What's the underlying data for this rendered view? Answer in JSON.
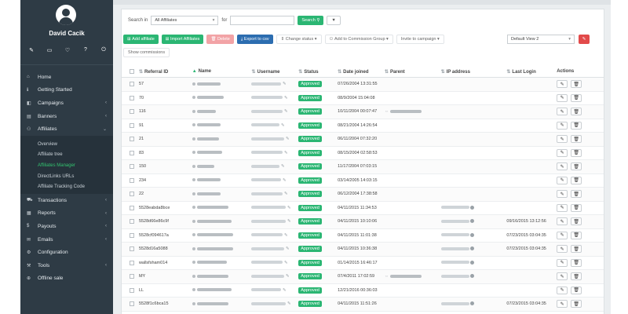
{
  "user": {
    "name": "David Cacik"
  },
  "toolbar_icons": [
    "pencil-icon",
    "monitor-icon",
    "heart-icon",
    "question-icon",
    "power-icon"
  ],
  "nav": [
    {
      "label": "Home",
      "icon": "home-icon",
      "chev": ""
    },
    {
      "label": "Getting Started",
      "icon": "info-icon",
      "chev": ""
    },
    {
      "label": "Campaigns",
      "icon": "campaign-icon",
      "chev": "‹"
    },
    {
      "label": "Banners",
      "icon": "banner-icon",
      "chev": "‹"
    },
    {
      "label": "Affiliates",
      "icon": "users-icon",
      "chev": "⌄"
    }
  ],
  "affiliates_sub": [
    "Overview",
    "Affiliate tree",
    "Affiliates Manager",
    "DirectLinks URLs",
    "Affiliate Tracking Code"
  ],
  "nav2": [
    {
      "label": "Transactions",
      "icon": "cart-icon",
      "chev": "‹"
    },
    {
      "label": "Reports",
      "icon": "chart-icon",
      "chev": "‹"
    },
    {
      "label": "Payouts",
      "icon": "money-icon",
      "chev": "‹"
    },
    {
      "label": "Emails",
      "icon": "mail-icon",
      "chev": "‹"
    },
    {
      "label": "Configuration",
      "icon": "gear-icon",
      "chev": ""
    },
    {
      "label": "Tools",
      "icon": "wrench-icon",
      "chev": "‹"
    },
    {
      "label": "Offline sale",
      "icon": "sale-icon",
      "chev": ""
    }
  ],
  "search": {
    "label_in": "Search in",
    "scope": "All Affiliates",
    "label_for": "for",
    "value": "",
    "button": "Search"
  },
  "actions": {
    "add": "Add affiliate",
    "import": "Import Affiliates",
    "delete": "Delete",
    "export": "Export to csv",
    "change_status": "Change status",
    "add_group": "Add to Commission Group",
    "invite": "Invite to campaign",
    "view": "Default View 2",
    "show_commissions": "Show commissions"
  },
  "columns": [
    "Referral ID",
    "Name",
    "Username",
    "Status",
    "Date joined",
    "Parent",
    "IP address",
    "Last Login",
    "Actions"
  ],
  "rows": [
    {
      "id": "57",
      "status": "Approved",
      "date": "07/26/2004 13:31:55",
      "parent": false,
      "ip": false,
      "login": ""
    },
    {
      "id": "70",
      "status": "Approved",
      "date": "08/9/2004 15:04:08",
      "parent": false,
      "ip": false,
      "login": ""
    },
    {
      "id": "116",
      "status": "Approved",
      "date": "10/11/2004 00:07:47",
      "parent": true,
      "ip": false,
      "login": ""
    },
    {
      "id": "91",
      "status": "Approved",
      "date": "08/21/2004 14:26:54",
      "parent": false,
      "ip": false,
      "login": ""
    },
    {
      "id": "21",
      "status": "Approved",
      "date": "06/11/2004 07:32:20",
      "parent": false,
      "ip": false,
      "login": ""
    },
    {
      "id": "83",
      "status": "Approved",
      "date": "08/15/2004 02:58:53",
      "parent": false,
      "ip": false,
      "login": ""
    },
    {
      "id": "150",
      "status": "Approved",
      "date": "11/17/2004 07:03:15",
      "parent": false,
      "ip": false,
      "login": ""
    },
    {
      "id": "234",
      "status": "Approved",
      "date": "03/14/2005 14:03:15",
      "parent": false,
      "ip": false,
      "login": ""
    },
    {
      "id": "22",
      "status": "Approved",
      "date": "06/12/2004 17:38:58",
      "parent": false,
      "ip": false,
      "login": ""
    },
    {
      "id": "5528eabda8bce",
      "status": "Approved",
      "date": "04/11/2015 11:34:53",
      "parent": false,
      "ip": true,
      "login": ""
    },
    {
      "id": "5528d66e86c9f",
      "status": "Approved",
      "date": "04/11/2015 10:10:06",
      "parent": false,
      "ip": true,
      "login": "09/16/2015 13:12:56"
    },
    {
      "id": "5528cf094617a",
      "status": "Approved",
      "date": "04/11/2015 11:01:38",
      "parent": false,
      "ip": true,
      "login": "07/23/2015 03:04:35"
    },
    {
      "id": "5528d16a5088",
      "status": "Approved",
      "date": "04/11/2015 10:36:38",
      "parent": false,
      "ip": true,
      "login": "07/23/2015 03:04:35"
    },
    {
      "id": "wallsfsham014",
      "status": "Approved",
      "date": "01/14/2015 16:46:17",
      "parent": false,
      "ip": true,
      "login": ""
    },
    {
      "id": "MY",
      "status": "Approved",
      "date": "07/4/2011 17:02:59",
      "parent": true,
      "ip": true,
      "login": ""
    },
    {
      "id": "LL",
      "status": "Approved",
      "date": "12/21/2016 00:36:03",
      "parent": false,
      "ip": false,
      "login": ""
    },
    {
      "id": "5528f1c6bca15",
      "status": "Approved",
      "date": "04/11/2015 11:51:26",
      "parent": false,
      "ip": true,
      "login": "07/23/2015 03:04:35"
    },
    {
      "id": "52f0e08c305f9",
      "status": "Approved",
      "date": "04/11/2015 13:43:56",
      "parent": false,
      "ip": true,
      "login": ""
    }
  ]
}
